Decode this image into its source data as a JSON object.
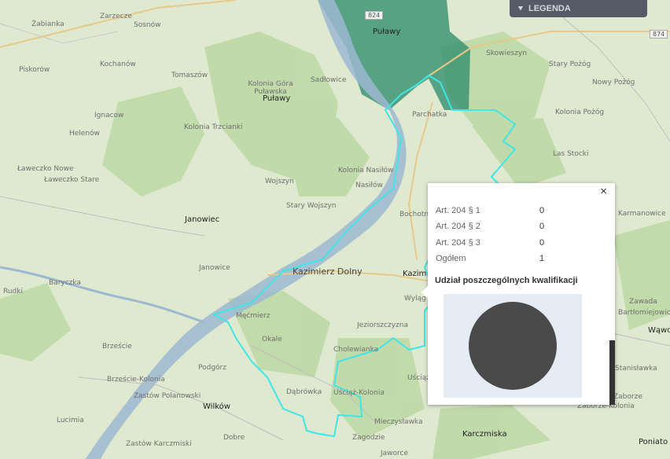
{
  "legend": {
    "label": "LEGENDA",
    "chevron_icon": "chevron-down-icon"
  },
  "roads": [
    "824",
    "874"
  ],
  "places": {
    "zarzecze": "Zarzecze",
    "sosnow": "Sosnów",
    "zabianka": "Żabianka",
    "kochanow": "Kochanów",
    "piskorow": "Piskorów",
    "tomaszow": "Tomaszów",
    "kolonia_gora_pulawska": "Kolonia Góra\nPuławska",
    "sadlowice": "Sadłowice",
    "pulawy_top": "Puławy",
    "pulawy_mid": "Puławy",
    "skowieszyn": "Skowieszyn",
    "stary_pozog": "Stary Pożóg",
    "nowy_pozog": "Nowy Pożóg",
    "kolonia_pozog": "Kolonia Pożóg",
    "las_stocki": "Las Stocki",
    "parchatka": "Parchatka",
    "ignacow": "Ignacow",
    "helenow": "Helenów",
    "kolonia_trzcianki": "Kolonia Trzcianki",
    "laweczko_nowe": "Ławeczko Nowe",
    "laweczko_stare": "Ławeczko Stare",
    "wojszyn": "Wojszyn",
    "kolonia_naslow": "Kolonia Nasiłów",
    "naslow": "Nasiłów",
    "janowiec": "Janowiec",
    "stary_wojszyn": "Stary Wojszyn",
    "bochotnica": "Bochotnica",
    "janowice": "Janowice",
    "kazimierz_dolny": "Kazimierz Dolny",
    "kazim": "Kazim",
    "wylag": "Wyląg",
    "baryczka": "Baryczka",
    "rudki": "Rudki",
    "karmanowice": "Karmanowice",
    "zawada": "Zawada",
    "bartlomiejowice": "Bartłomiejowice",
    "wawol": "Wąwol",
    "miecmierz": "Męćmierz",
    "okale": "Okale",
    "jeziorszczyzna": "Jeziorszczyzna",
    "cholewianka": "Cholewianka",
    "brzesce": "Brzeście",
    "podgorz": "Podgórz",
    "uściąz": "Uściąż",
    "brzesce_kolonia": "Brzeście-Kolonia",
    "dabrowka": "Dąbrówka",
    "usciaz_kolonia": "Uściąż-Kolonia",
    "zastow_polanowski": "Zastów Polanowski",
    "wilkow": "Wilków",
    "lucimia": "Lucimia",
    "zastow_karczmiski": "Zastów Karczmiski",
    "dobre": "Dobre",
    "zagodzie": "Zagodzie",
    "mieczyslawka": "Mieczysławka",
    "karczmiska": "Karczmiska",
    "jaworce": "Jaworce",
    "stanislawka": "Stanisławka",
    "zaborze": "Zaborze",
    "zaborze_kolonia": "Zaborze-Kolonia",
    "poniatowa": "Poniato"
  },
  "popup": {
    "close_label": "×",
    "rows": [
      {
        "label": "Art. 204 § 1",
        "value": "0"
      },
      {
        "label": "Art. 204 § 2",
        "value": "0"
      },
      {
        "label": "Art. 204 § 3",
        "value": "0"
      },
      {
        "label": "Ogółem",
        "value": "1"
      }
    ],
    "chart_title": "Udział poszczególnych kwalifikacji",
    "pie_color": "#4a4a4a"
  },
  "colors": {
    "boundary": "#3fe6e6",
    "district_fill": "#1f7a5e",
    "river": "#8aa9c9",
    "forest": "#bcd9a4"
  }
}
